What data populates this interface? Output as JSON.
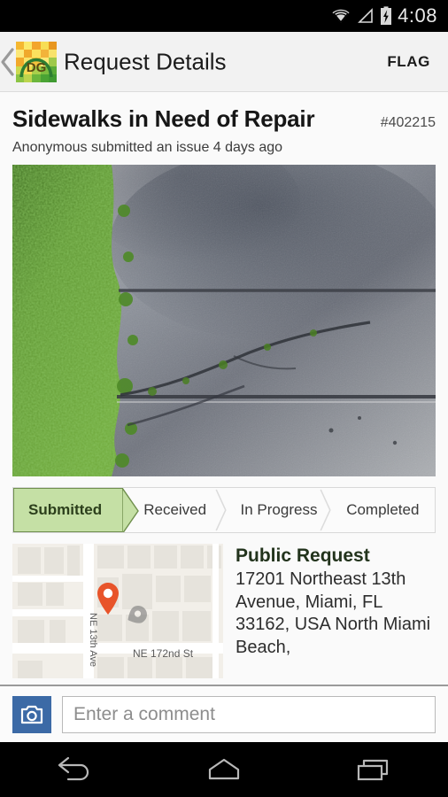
{
  "status_bar": {
    "time": "4:08",
    "icons": [
      "wifi-icon",
      "cell-signal-icon",
      "battery-charging-icon"
    ]
  },
  "app_bar": {
    "back_label": "‹",
    "app_icon_name": "dg-app-icon",
    "title": "Request Details",
    "flag_label": "FLAG"
  },
  "request": {
    "title": "Sidewalks in Need of Repair",
    "id": "#402215",
    "meta": "Anonymous submitted an issue 4 days ago",
    "photo_alt": "cracked-sidewalk-photo"
  },
  "status_steps": [
    {
      "label": "Submitted",
      "active": true
    },
    {
      "label": "Received",
      "active": false
    },
    {
      "label": "In Progress",
      "active": false
    },
    {
      "label": "Completed",
      "active": false
    }
  ],
  "location": {
    "heading": "Public Request",
    "address": "17201 Northeast 13th Avenue, Miami, FL 33162, USA North Miami Beach,",
    "map_labels": {
      "vertical_street": "NE 13th Ave",
      "horizontal_street": "NE 172nd St"
    },
    "pin_color": "#e8542a"
  },
  "comment_bar": {
    "camera_icon": "camera-icon",
    "input_value": "",
    "input_placeholder": "Enter a comment"
  },
  "nav_bar": {
    "back": "back-icon",
    "home": "home-icon",
    "recents": "recents-icon"
  },
  "colors": {
    "accent_green": "#c5e0a5",
    "accent_green_border": "#6f8f4d",
    "camera_blue": "#3c6aa6",
    "appbar_bg": "#f2f2f2"
  }
}
